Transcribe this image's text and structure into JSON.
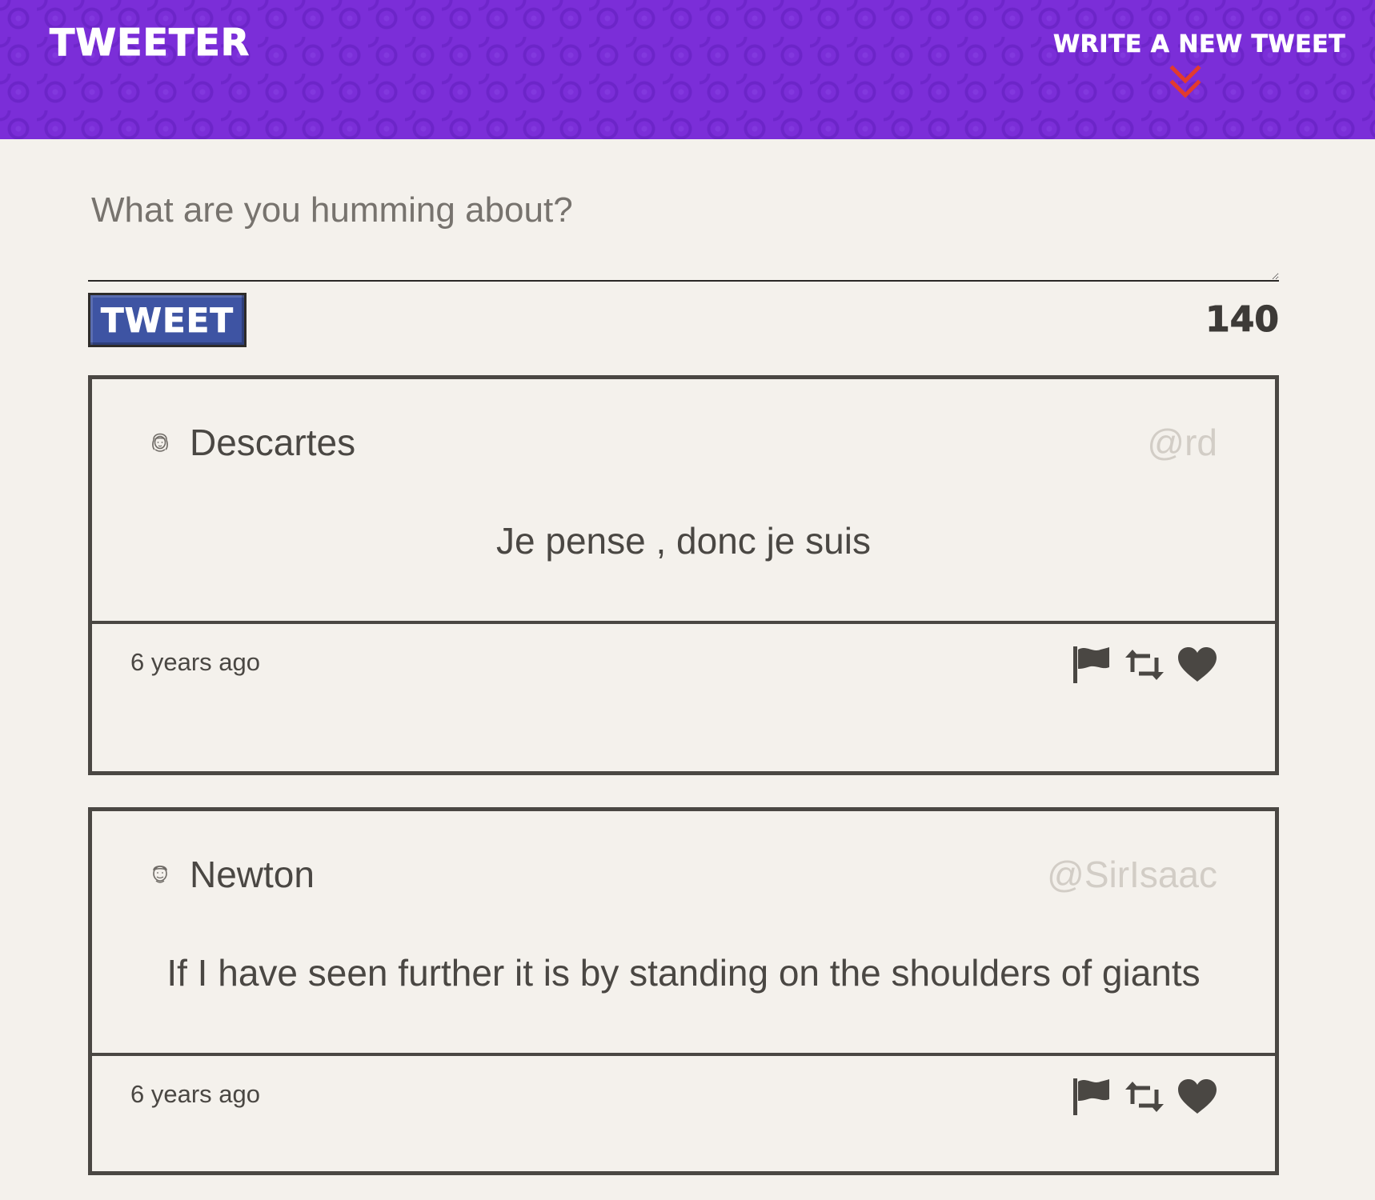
{
  "nav": {
    "brand": "TWEETER",
    "compose_label": "WRITE A NEW TWEET",
    "chevron_color": "#e23b2e",
    "background": "#7b2ed8"
  },
  "composer": {
    "placeholder": "What are you humming about?",
    "value": "",
    "button_label": "TWEET",
    "char_count": "140",
    "button_color": "#3e54a3"
  },
  "tweets": [
    {
      "avatar": "avatar-icon",
      "author": "Descartes",
      "handle": "@rd",
      "text": "Je pense , donc je suis",
      "time": "6 years ago",
      "actions": [
        "flag-icon",
        "retweet-icon",
        "heart-icon"
      ]
    },
    {
      "avatar": "avatar-icon",
      "author": "Newton",
      "handle": "@SirIsaac",
      "text": "If I have seen further it is by standing on the shoulders of giants",
      "time": "6 years ago",
      "actions": [
        "flag-icon",
        "retweet-icon",
        "heart-icon"
      ]
    }
  ]
}
